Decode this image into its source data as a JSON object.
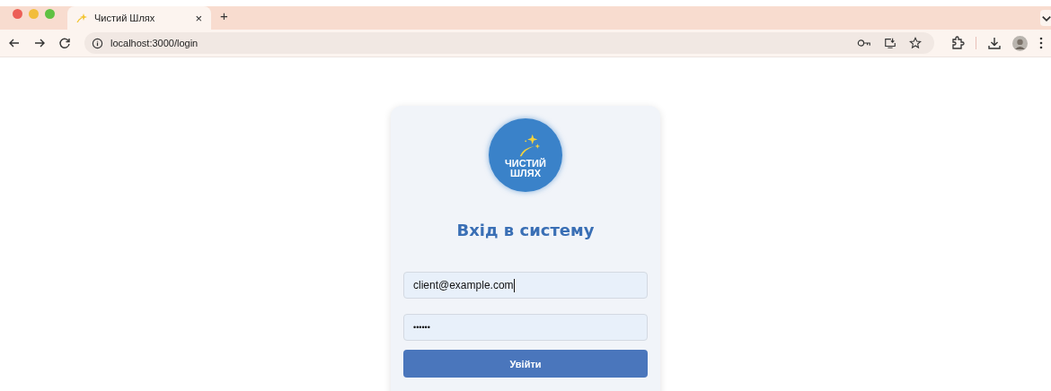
{
  "browser": {
    "tabs": [
      {
        "title": "Чистий Шлях",
        "close": "×",
        "selected": true
      }
    ],
    "new_tab": "+",
    "address": "localhost:3000/login"
  },
  "login": {
    "logo_lines": [
      "ЧИСТИЙ",
      "ШЛЯХ"
    ],
    "title": "Вхід в систему",
    "email": {
      "value": "client@example.com"
    },
    "password": {
      "value": "••••••"
    },
    "submit": "Увійти"
  }
}
